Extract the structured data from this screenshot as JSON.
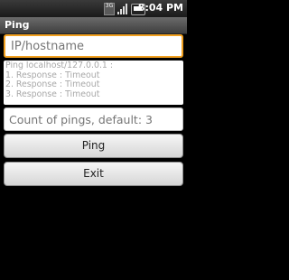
{
  "status_bar": {
    "time": "8:04 PM",
    "icons": [
      "data-3g-icon",
      "signal-icon",
      "battery-icon"
    ]
  },
  "app": {
    "title": "Ping"
  },
  "host_input": {
    "placeholder": "IP/hostname",
    "value": ""
  },
  "output": {
    "lines": [
      "Ping localhost/127.0.0.1 :",
      "1. Response : Timeout",
      "2. Response : Timeout",
      "3. Response : Timeout"
    ]
  },
  "count_input": {
    "placeholder": "Count of pings, default: 3",
    "value": ""
  },
  "buttons": {
    "ping_label": "Ping",
    "exit_label": "Exit"
  },
  "colors": {
    "focus_border": "#f1a020",
    "title_bar": "#4f4f4f"
  }
}
